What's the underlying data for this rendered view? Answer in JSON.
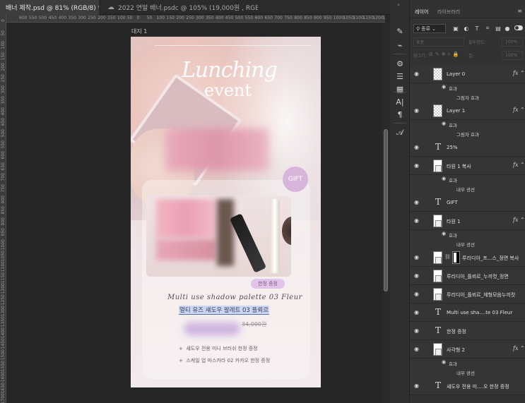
{
  "tabs": [
    {
      "label": "배너 제작.psd @ 81% (RGB/8) *",
      "close": "×"
    },
    {
      "label": "2022 연말 배너.psdc @ 105% (19,000원 , RGB/8*)",
      "close": "×",
      "icon": "cloud-icon"
    }
  ],
  "ruler": {
    "h": [
      "600",
      "550",
      "500",
      "450",
      "400",
      "350",
      "300",
      "250",
      "200",
      "150",
      "100",
      "50",
      "0",
      "50",
      "100",
      "150",
      "200",
      "250",
      "300",
      "350",
      "400",
      "450",
      "500",
      "550",
      "600",
      "650",
      "700",
      "750",
      "800",
      "850",
      "900",
      "950",
      "1000",
      "1050",
      "1100",
      "1150",
      "1200",
      "1250",
      "1300"
    ],
    "v": [
      "0",
      "50",
      "100",
      "150",
      "200",
      "250",
      "300",
      "350",
      "400",
      "450",
      "500",
      "550",
      "600",
      "650",
      "700",
      "750",
      "800",
      "850",
      "900",
      "950",
      "1000",
      "1050",
      "1100",
      "1150",
      "1200",
      "1250",
      "1300",
      "1350",
      "1400",
      "1450",
      "1500",
      "1550",
      "1600",
      "1650",
      "1700"
    ]
  },
  "artboard": {
    "label": "대지 1",
    "title_line1": "Lunching",
    "title_line2": "event",
    "gift": "GIFT",
    "badge": "한정 증정",
    "script_title": "Multi use shadow palette 03 Fleur",
    "product_name": "멀티 유즈 섀도우 팔레트 03 플뢰르",
    "price": "34,000원",
    "bullets": [
      "섀도우 전용 미니 브러쉬 한정 증정",
      "스케일 업 마스카라 02 카카오 한정 증정"
    ],
    "bullet_mark": "+"
  },
  "tools": [
    "brush-settings-icon",
    "adjustments-icon",
    "properties-icon",
    "libraries-icon",
    "character-icon",
    "paragraph-icon",
    "glyphs-icon"
  ],
  "panel": {
    "tab_layers": "레이어",
    "tab_libraries": "라이브러리",
    "menu": "≡",
    "collapse": "«",
    "kind_label": "종류",
    "blend_mode": "표준",
    "opacity_label": "불투명도:",
    "opacity_value": "100%",
    "lock_label": "잠그기:",
    "fill_label": "칠:",
    "fill_value": "100%"
  },
  "layers": [
    {
      "type": "pixel",
      "name": "Layer 0",
      "fx": true,
      "subs": [
        "효과",
        "그림자 효과"
      ]
    },
    {
      "type": "pixel",
      "name": "Layer 1",
      "fx": true,
      "subs": [
        "효과",
        "그림자 효과"
      ]
    },
    {
      "type": "text",
      "name": "25%",
      "fx": false,
      "subs": []
    },
    {
      "type": "shape",
      "name": "타원 1 복사",
      "fx": true,
      "subs": [
        "효과",
        "내부 광선"
      ]
    },
    {
      "type": "text",
      "name": "GIFT",
      "fx": false,
      "subs": []
    },
    {
      "type": "shape",
      "name": "타원 1",
      "fx": true,
      "subs": [
        "효과",
        "내부 광선"
      ]
    },
    {
      "type": "masked",
      "name": "루리디아_프...스_정면 복사",
      "fx": false,
      "subs": []
    },
    {
      "type": "smart",
      "name": "루리디아_플뢰르_누끼컷_정면",
      "fx": false,
      "subs": []
    },
    {
      "type": "smart",
      "name": "루리디아_플뢰르_체형모음누끼컷",
      "fx": false,
      "subs": []
    },
    {
      "type": "text",
      "name": "Multi use sha....te 03 Fleur",
      "fx": false,
      "subs": []
    },
    {
      "type": "text",
      "name": "한정 증정",
      "fx": false,
      "subs": []
    },
    {
      "type": "shape",
      "name": "사각형 2",
      "fx": true,
      "subs": [
        "효과",
        "내부 광선"
      ]
    },
    {
      "type": "text",
      "name": "섀도우 전용 미....오 한정 증정",
      "fx": false,
      "subs": []
    }
  ]
}
